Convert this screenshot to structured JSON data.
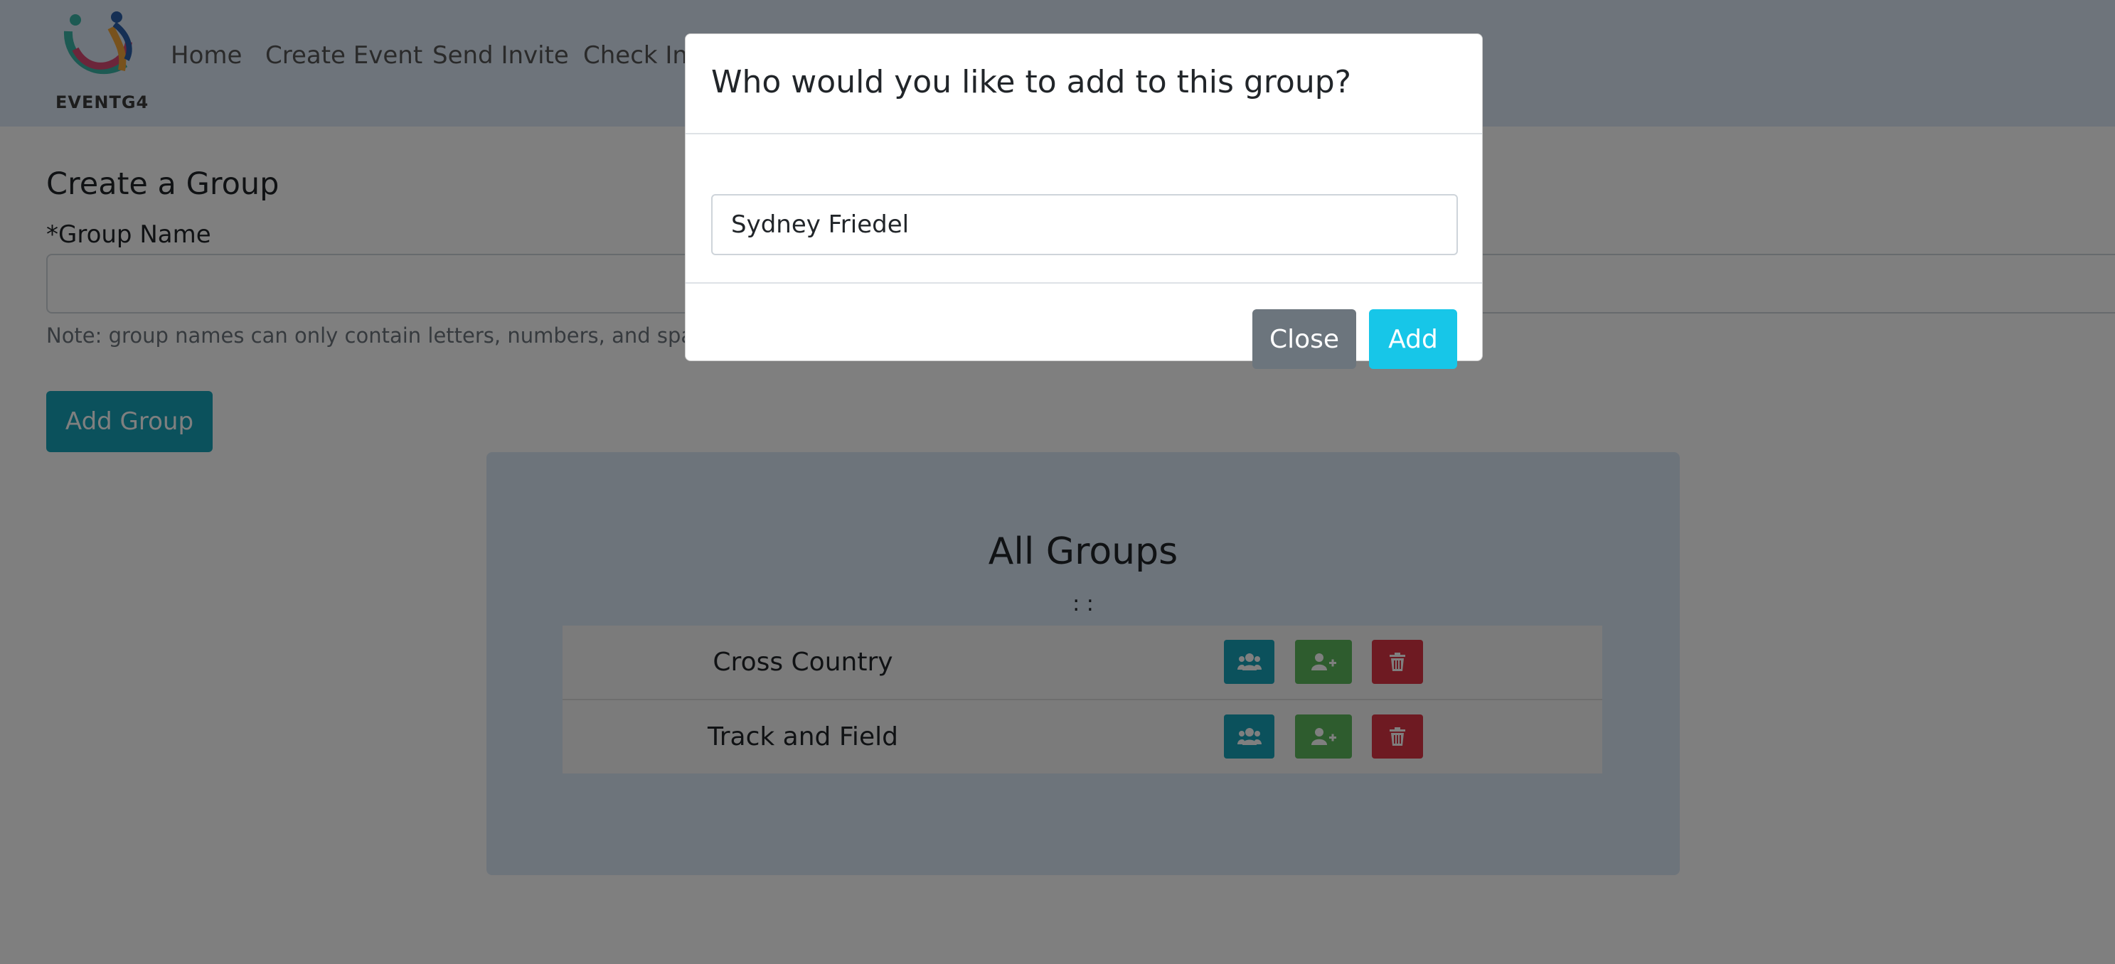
{
  "brand": {
    "name": "EVENTG4",
    "logo_icon": "people-swirl-logo"
  },
  "nav": {
    "links": [
      "Home",
      "Create Event",
      "Send Invite",
      "Check In/"
    ]
  },
  "form": {
    "heading": "Create a Group",
    "group_name_label": "*Group Name",
    "group_name_value": "",
    "note": "Note: group names can only contain letters, numbers, and spaces",
    "submit_label": "Add Group"
  },
  "groups": {
    "title": "All Groups",
    "subtitle": ": :",
    "rows": [
      {
        "name": "Cross Country",
        "actions": [
          "users-icon",
          "user-plus-icon",
          "trash-icon"
        ]
      },
      {
        "name": "Track and Field",
        "actions": [
          "users-icon",
          "user-plus-icon",
          "trash-icon"
        ]
      }
    ]
  },
  "modal": {
    "title": "Who would you like to add to this group?",
    "input_value": "Sydney Friedel",
    "close_label": "Close",
    "add_label": "Add"
  },
  "colors": {
    "navbar_bg": "#dde9f7",
    "info": "#17a2b8",
    "success": "#5cb85c",
    "danger": "#dc3545",
    "secondary": "#6c757d",
    "add_accent": "#17c6e8"
  }
}
